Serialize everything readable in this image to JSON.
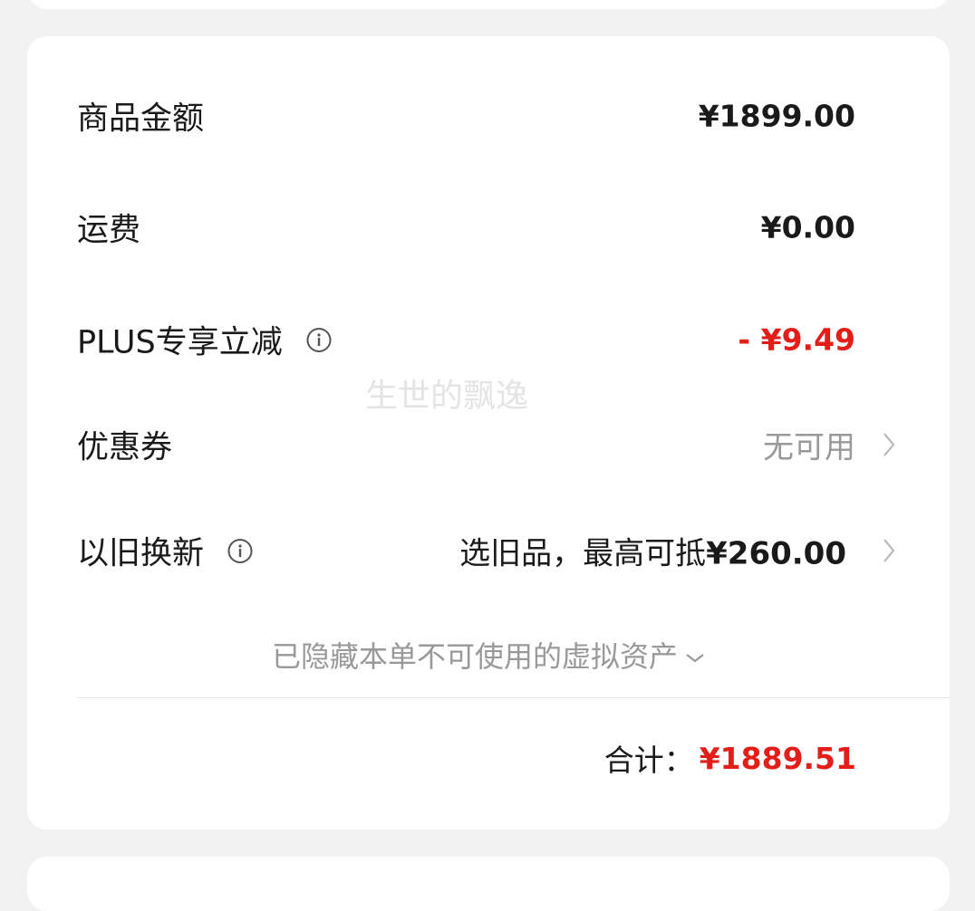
{
  "summary": {
    "goods_amount": {
      "label": "商品金额",
      "value": "¥1899.00"
    },
    "shipping": {
      "label": "运费",
      "value": "¥0.00"
    },
    "plus_discount": {
      "label": "PLUS专享立减",
      "value": "- ¥9.49"
    },
    "coupon": {
      "label": "优惠券",
      "value": "无可用"
    },
    "trade_in": {
      "label": "以旧换新",
      "value_prefix": "选旧品，最高可抵",
      "value_amount": "¥260.00"
    },
    "hidden_assets_text": "已隐藏本单不可使用的虚拟资产",
    "total": {
      "label": "合计：",
      "value": "¥1889.51"
    }
  },
  "watermark": "生世的飘逸",
  "colors": {
    "accent_red": "#e31e19",
    "muted_grey": "#999999",
    "card_bg": "#ffffff",
    "page_bg": "#f2f2f2"
  },
  "icons": [
    "info-icon",
    "chevron-right-icon",
    "chevron-down-icon"
  ]
}
